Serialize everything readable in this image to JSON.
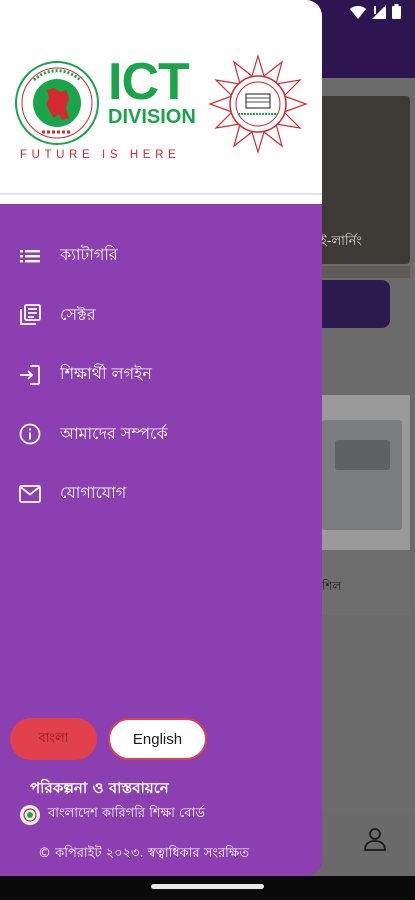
{
  "status_bar": {
    "icons": [
      "wifi-icon",
      "signal-icon",
      "battery-icon"
    ]
  },
  "background": {
    "card1_text": "ই-লার্নিং",
    "card2_text": "শিল"
  },
  "header": {
    "logo_ict_main": "ICT",
    "logo_ict_sub": "DIVISION",
    "tagline": "FUTURE IS HERE",
    "colors": {
      "ict_green": "#1aa54a",
      "tagline_red": "#d4292f"
    }
  },
  "menu": {
    "items": [
      {
        "icon": "list-icon",
        "label": "ক্যাটাগরি"
      },
      {
        "icon": "library-icon",
        "label": "সেক্টর"
      },
      {
        "icon": "login-icon",
        "label": "শিক্ষার্থী লগইন"
      },
      {
        "icon": "info-icon",
        "label": "আমাদের সম্পর্কে"
      },
      {
        "icon": "mail-icon",
        "label": "যোগাযোগ"
      }
    ]
  },
  "language": {
    "bangla_label": "বাংলা",
    "english_label": "English"
  },
  "footer": {
    "plan_title": "পরিকল্পনা ও বাস্তবায়নে",
    "board_name": "বাংলাদেশ কারিগরি শিক্ষা বোর্ড",
    "copyright": "© কপিরাইট ২০২৩. স্বত্বাধিকার সংরক্ষিত"
  },
  "theme": {
    "drawer_purple": "#8b3fb1",
    "accent_red": "#e0414d"
  }
}
